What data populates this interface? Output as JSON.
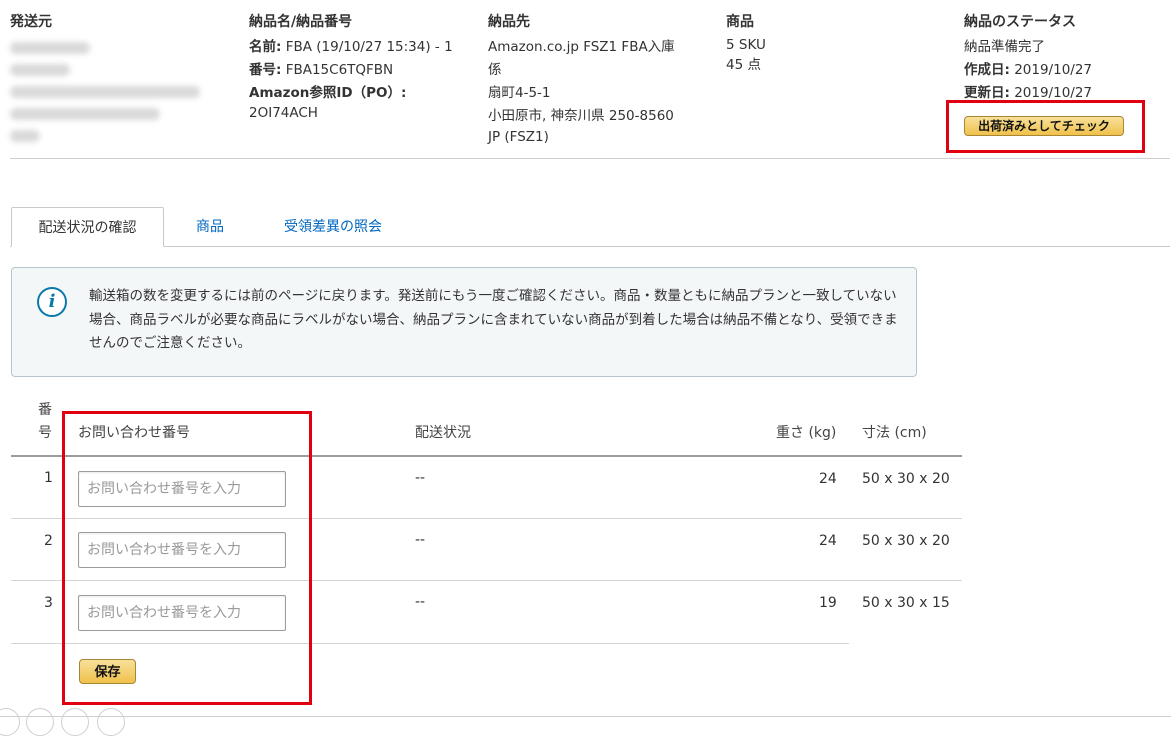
{
  "header": {
    "sender": {
      "title": "発送元"
    },
    "shipment": {
      "title": "納品名/納品番号",
      "name_label": "名前:",
      "name_value": "FBA (19/10/27 15:34) - 1",
      "number_label": "番号:",
      "number_value": "FBA15C6TQFBN",
      "po_label": "Amazon参照ID（PO）:",
      "po_value": "2OI74ACH"
    },
    "destination": {
      "title": "納品先",
      "lines": [
        "Amazon.co.jp FSZ1 FBA入庫",
        "係",
        "扇町4-5-1",
        "小田原市, 神奈川県 250-8560",
        "JP (FSZ1)"
      ]
    },
    "products": {
      "title": "商品",
      "sku": "5 SKU",
      "units": "45 点"
    },
    "status": {
      "title": "納品のステータス",
      "value": "納品準備完了",
      "created_label": "作成日:",
      "created_value": "2019/10/27",
      "updated_label": "更新日:",
      "updated_value": "2019/10/27",
      "mark_shipped_button": "出荷済みとしてチェック"
    }
  },
  "tabs": [
    "配送状況の確認",
    "商品",
    "受領差異の照会"
  ],
  "alert": {
    "icon": "info-icon",
    "text": "輸送箱の数を変更するには前のページに戻ります。発送前にもう一度ご確認ください。商品・数量ともに納品プランと一致していない場合、商品ラベルが必要な商品にラベルがない場合、納品プランに含まれていない商品が到着した場合は納品不備となり、受領できませんのでご注意ください。"
  },
  "table": {
    "headers": {
      "number_line1": "番",
      "number_line2": "号",
      "tracking": "お問い合わせ番号",
      "status": "配送状況",
      "weight": "重さ (kg)",
      "dimensions": "寸法 (cm)"
    },
    "rows": [
      {
        "no": "1",
        "tracking_placeholder": "お問い合わせ番号を入力",
        "status": "--",
        "weight": "24",
        "dimensions": "50 x 30 x 20"
      },
      {
        "no": "2",
        "tracking_placeholder": "お問い合わせ番号を入力",
        "status": "--",
        "weight": "24",
        "dimensions": "50 x 30 x 20"
      },
      {
        "no": "3",
        "tracking_placeholder": "お問い合わせ番号を入力",
        "status": "--",
        "weight": "19",
        "dimensions": "50 x 30 x 15"
      }
    ],
    "save_button": "保存"
  },
  "colors": {
    "highlight": "#e0000f",
    "link": "#0066c0",
    "button_yellow": "#f0c14b",
    "info_blue": "#0a79a9"
  }
}
